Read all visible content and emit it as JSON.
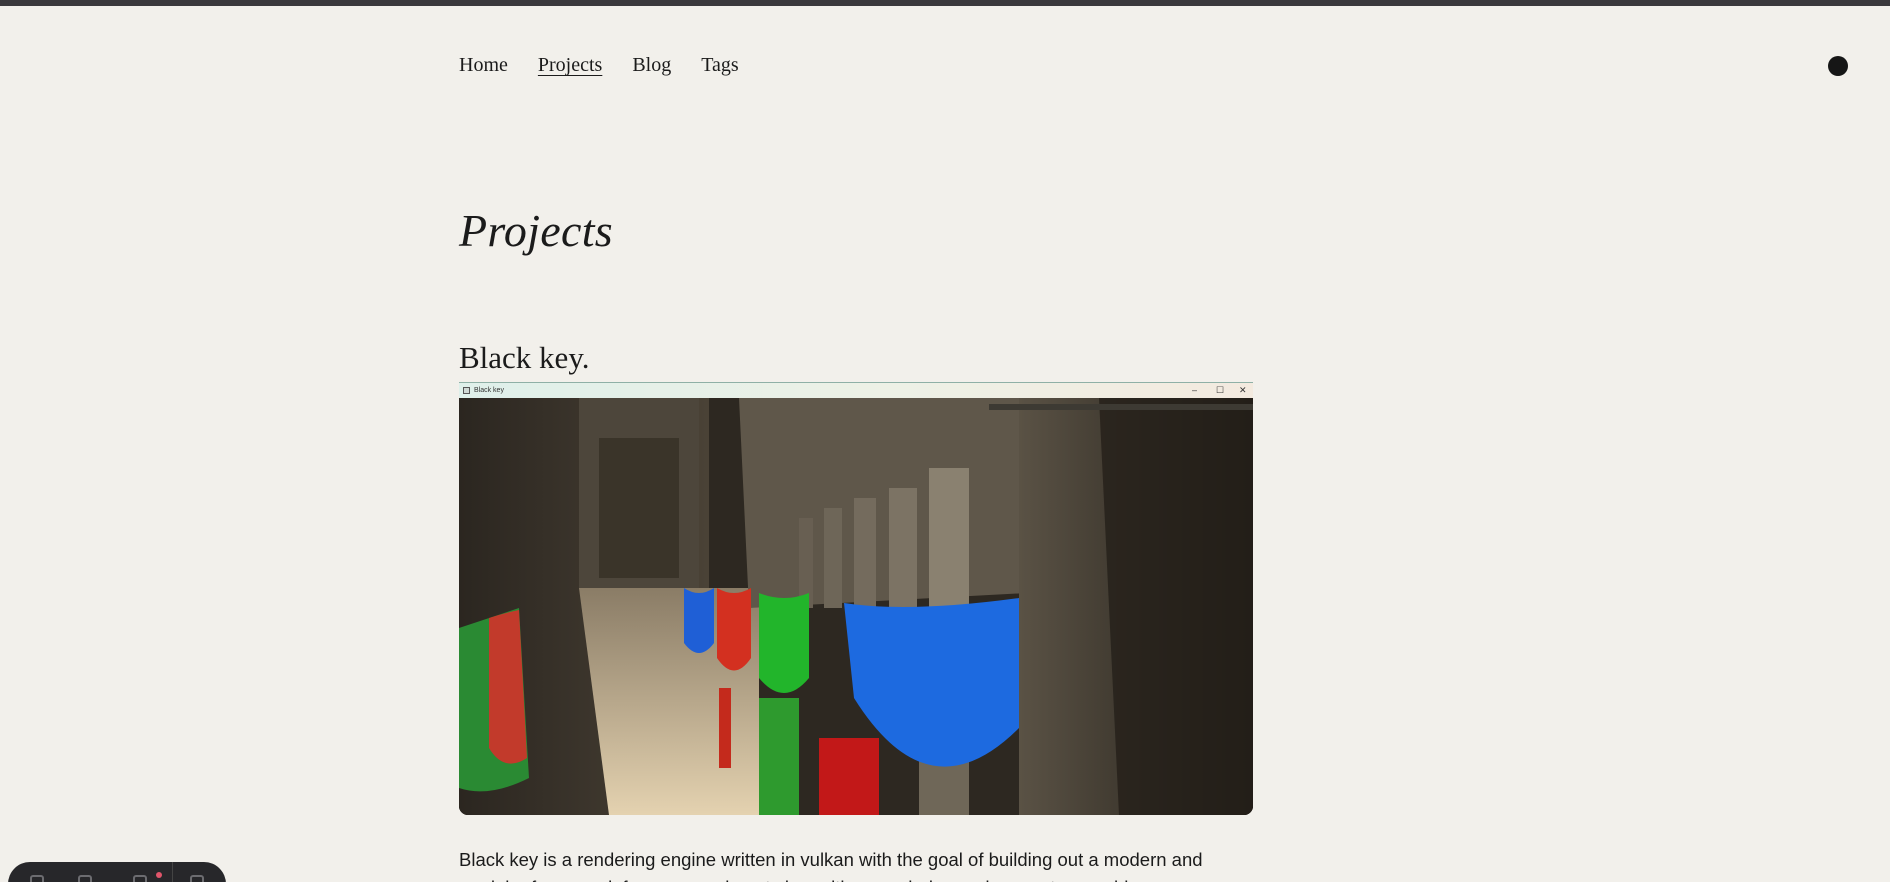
{
  "nav": {
    "items": [
      {
        "label": "Home",
        "active": false
      },
      {
        "label": "Projects",
        "active": true
      },
      {
        "label": "Blog",
        "active": false
      },
      {
        "label": "Tags",
        "active": false
      }
    ]
  },
  "theme_toggle": {
    "icon": "theme-toggle-dot-icon",
    "color": "#161616"
  },
  "page": {
    "title": "Projects"
  },
  "project": {
    "title": "Black key.",
    "screenshot": {
      "window_title": "Black key",
      "controls": [
        "–",
        "☐",
        "✕"
      ]
    },
    "description": "Black key is a rendering engine written in vulkan with the goal of building out a modern and modular framework for my experiments in realtime rendering and computer graphics."
  },
  "colors": {
    "background": "#f2f0eb",
    "text": "#1b1b1b",
    "top_strip": "#3a393c",
    "dock": "#27272a"
  },
  "dock": {
    "icons": [
      "dock-app-icon",
      "dock-settings-icon",
      "dock-menu-icon",
      "dock-extension-icon"
    ]
  }
}
